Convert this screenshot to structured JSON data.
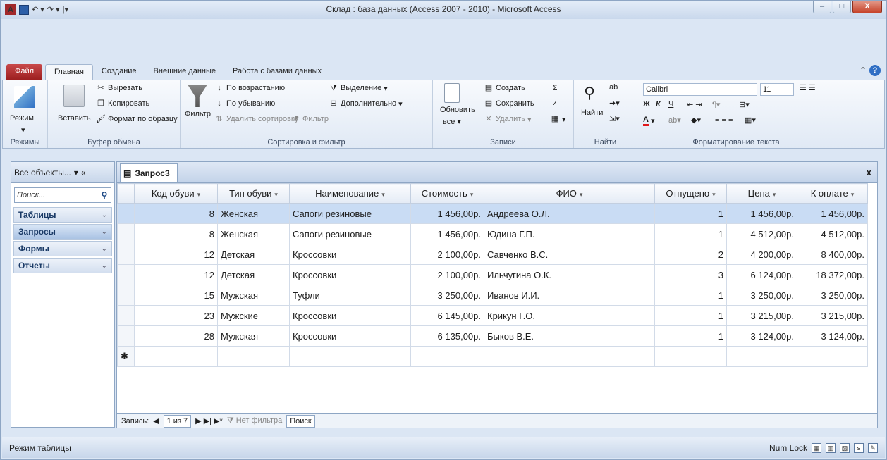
{
  "window": {
    "title": "Склад : база данных (Access 2007 - 2010) - Microsoft Access"
  },
  "ribbon_tabs": [
    "Файл",
    "Главная",
    "Создание",
    "Внешние данные",
    "Работа с базами данных"
  ],
  "ribbon": {
    "views": {
      "mode": "Режим",
      "label": "Режимы"
    },
    "clipboard": {
      "paste": "Вставить",
      "cut": "Вырезать",
      "copy": "Копировать",
      "format": "Формат по образцу",
      "label": "Буфер обмена"
    },
    "sort": {
      "filter": "Фильтр",
      "asc": "По возрастанию",
      "desc": "По убыванию",
      "remove": "Удалить сортировку",
      "selection": "Выделение",
      "advanced": "Дополнительно",
      "toggle": "Фильтр",
      "label": "Сортировка и фильтр"
    },
    "records": {
      "refresh": "Обновить",
      "refresh_all": "все",
      "new": "Создать",
      "save": "Сохранить",
      "delete": "Удалить",
      "label": "Записи"
    },
    "find": {
      "find": "Найти",
      "label": "Найти"
    },
    "text": {
      "font": "Calibri",
      "size": "11",
      "bold": "Ж",
      "italic": "К",
      "underline": "Ч",
      "label": "Форматирование текста"
    }
  },
  "nav": {
    "header": "Все объекты...",
    "search_placeholder": "Поиск...",
    "items": [
      "Таблицы",
      "Запросы",
      "Формы",
      "Отчеты"
    ],
    "selected": "Запросы"
  },
  "doc": {
    "tab": "Запрос3"
  },
  "grid": {
    "columns": [
      "Код обуви",
      "Тип обуви",
      "Наименование",
      "Стоимость",
      "ФИО",
      "Отпущено",
      "Цена",
      "К оплате"
    ],
    "rows": [
      [
        "8",
        "Женская",
        "Сапоги резиновые",
        "1 456,00р.",
        "Андреева О.Л.",
        "1",
        "1 456,00р.",
        "1 456,00р."
      ],
      [
        "8",
        "Женская",
        "Сапоги резиновые",
        "1 456,00р.",
        "Юдина Г.П.",
        "1",
        "4 512,00р.",
        "4 512,00р."
      ],
      [
        "12",
        "Детская",
        "Кроссовки",
        "2 100,00р.",
        "Савченко В.С.",
        "2",
        "4 200,00р.",
        "8 400,00р."
      ],
      [
        "12",
        "Детская",
        "Кроссовки",
        "2 100,00р.",
        "Ильчугина О.К.",
        "3",
        "6 124,00р.",
        "18 372,00р."
      ],
      [
        "15",
        "Мужская",
        "Туфли",
        "3 250,00р.",
        "Иванов И.И.",
        "1",
        "3 250,00р.",
        "3 250,00р."
      ],
      [
        "23",
        "Мужские",
        "Кроссовки",
        "6 145,00р.",
        "Крикун Г.О.",
        "1",
        "3 215,00р.",
        "3 215,00р."
      ],
      [
        "28",
        "Мужская",
        "Кроссовки",
        "6 135,00р.",
        "Быков В.Е.",
        "1",
        "3 124,00р.",
        "3 124,00р."
      ]
    ]
  },
  "recordbar": {
    "label": "Запись:",
    "pos": "1 из 7",
    "filter": "Нет фильтра",
    "search": "Поиск"
  },
  "status": {
    "mode": "Режим таблицы",
    "numlock": "Num Lock"
  }
}
